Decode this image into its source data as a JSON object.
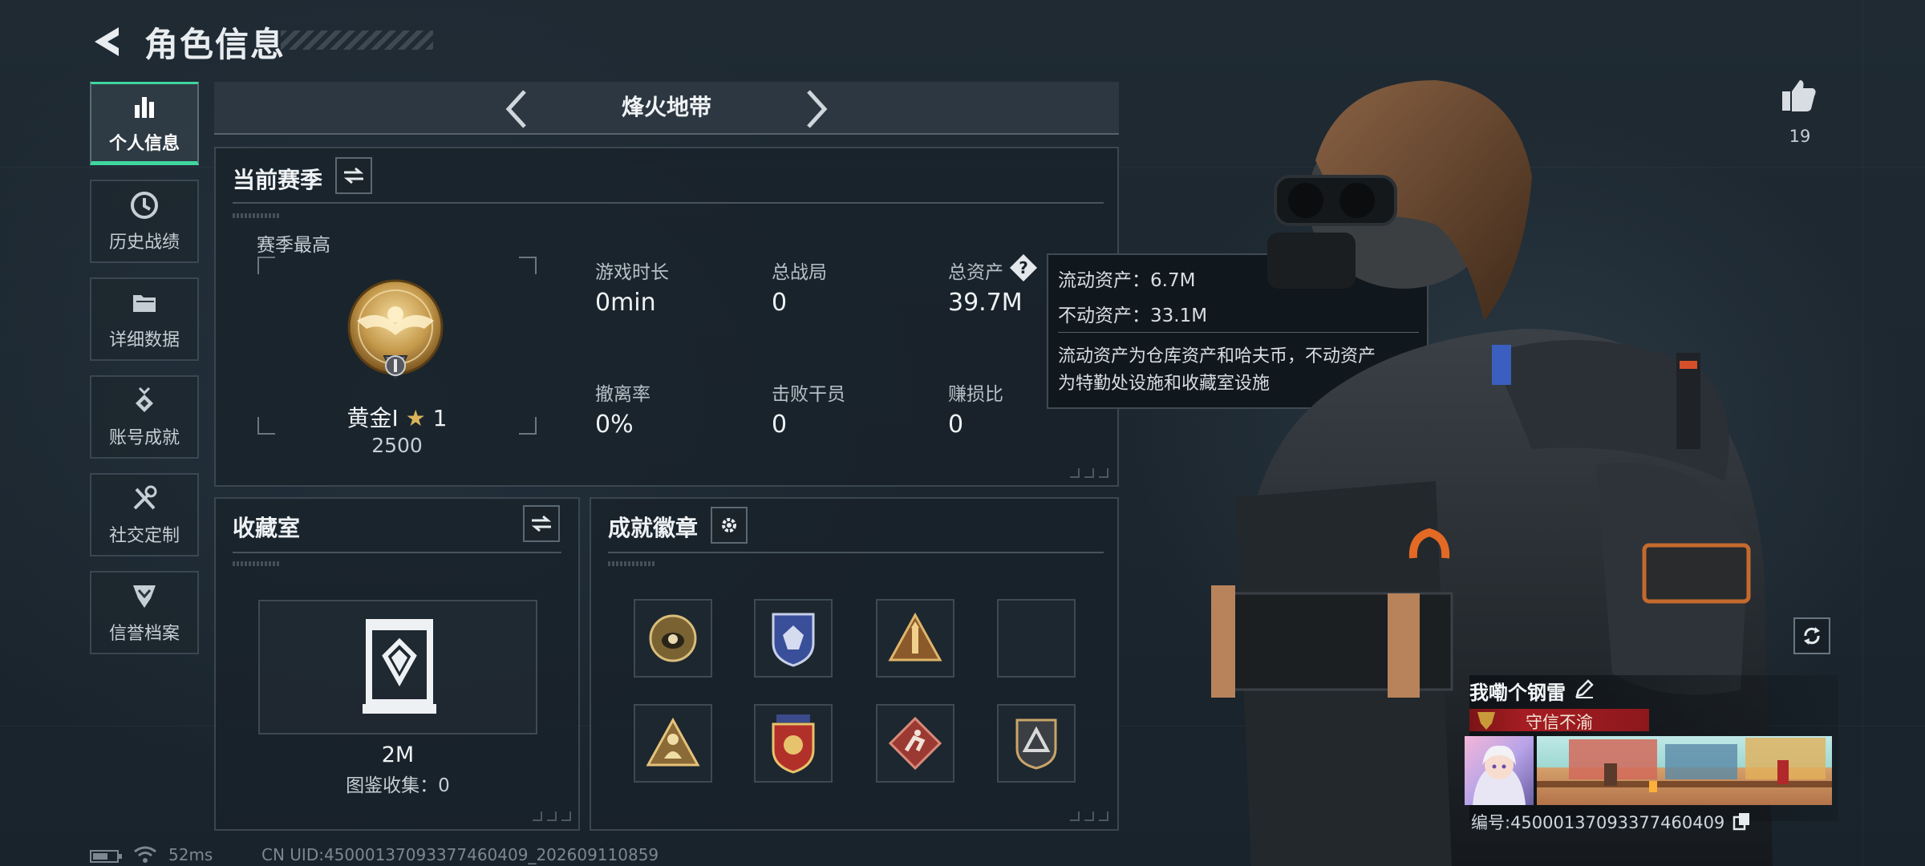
{
  "header": {
    "title": "角色信息"
  },
  "sidebar": {
    "items": [
      {
        "label": "个人信息",
        "icon": "bar-chart-icon",
        "active": true
      },
      {
        "label": "历史战绩",
        "icon": "clock-icon",
        "active": false
      },
      {
        "label": "详细数据",
        "icon": "folder-icon",
        "active": false
      },
      {
        "label": "账号成就",
        "icon": "medal-icon",
        "active": false
      },
      {
        "label": "社交定制",
        "icon": "tools-icon",
        "active": false
      },
      {
        "label": "信誉档案",
        "icon": "shield-chevron-icon",
        "active": false
      }
    ]
  },
  "mode": {
    "title": "烽火地带"
  },
  "season": {
    "title": "当前赛季",
    "best_label": "赛季最高",
    "rank_name": "黄金I",
    "rank_stars": "1",
    "rank_points": "2500",
    "stats": [
      {
        "label": "游戏时长",
        "value": "0min"
      },
      {
        "label": "总战局",
        "value": "0"
      },
      {
        "label": "总资产",
        "value": "39.7M"
      },
      {
        "label": "撤离率",
        "value": "0%"
      },
      {
        "label": "击败干员",
        "value": "0"
      },
      {
        "label": "赚损比",
        "value": "0"
      }
    ]
  },
  "tooltip": {
    "liquid": "流动资产：6.7M",
    "fixed": "不动资产：33.1M",
    "desc_line1": "流动资产为仓库资产和哈夫币，不动资产",
    "desc_line2": "为特勤处设施和收藏室设施"
  },
  "collection": {
    "title": "收藏室",
    "value": "2M",
    "catalog": "图鉴收集：0"
  },
  "achievements": {
    "title": "成就徽章"
  },
  "profile": {
    "likes": "19",
    "nickname": "我嘞个钢雷",
    "reputation": "守信不渝",
    "id_text": "编号:450001370933774604​09"
  },
  "status": {
    "ping": "52ms",
    "uid": "CN UID:450001370933774604​09_202609110859"
  },
  "colors": {
    "accent": "#3fd6a0",
    "reputation_red": "#a51d22",
    "gold": "#c9a24a"
  }
}
